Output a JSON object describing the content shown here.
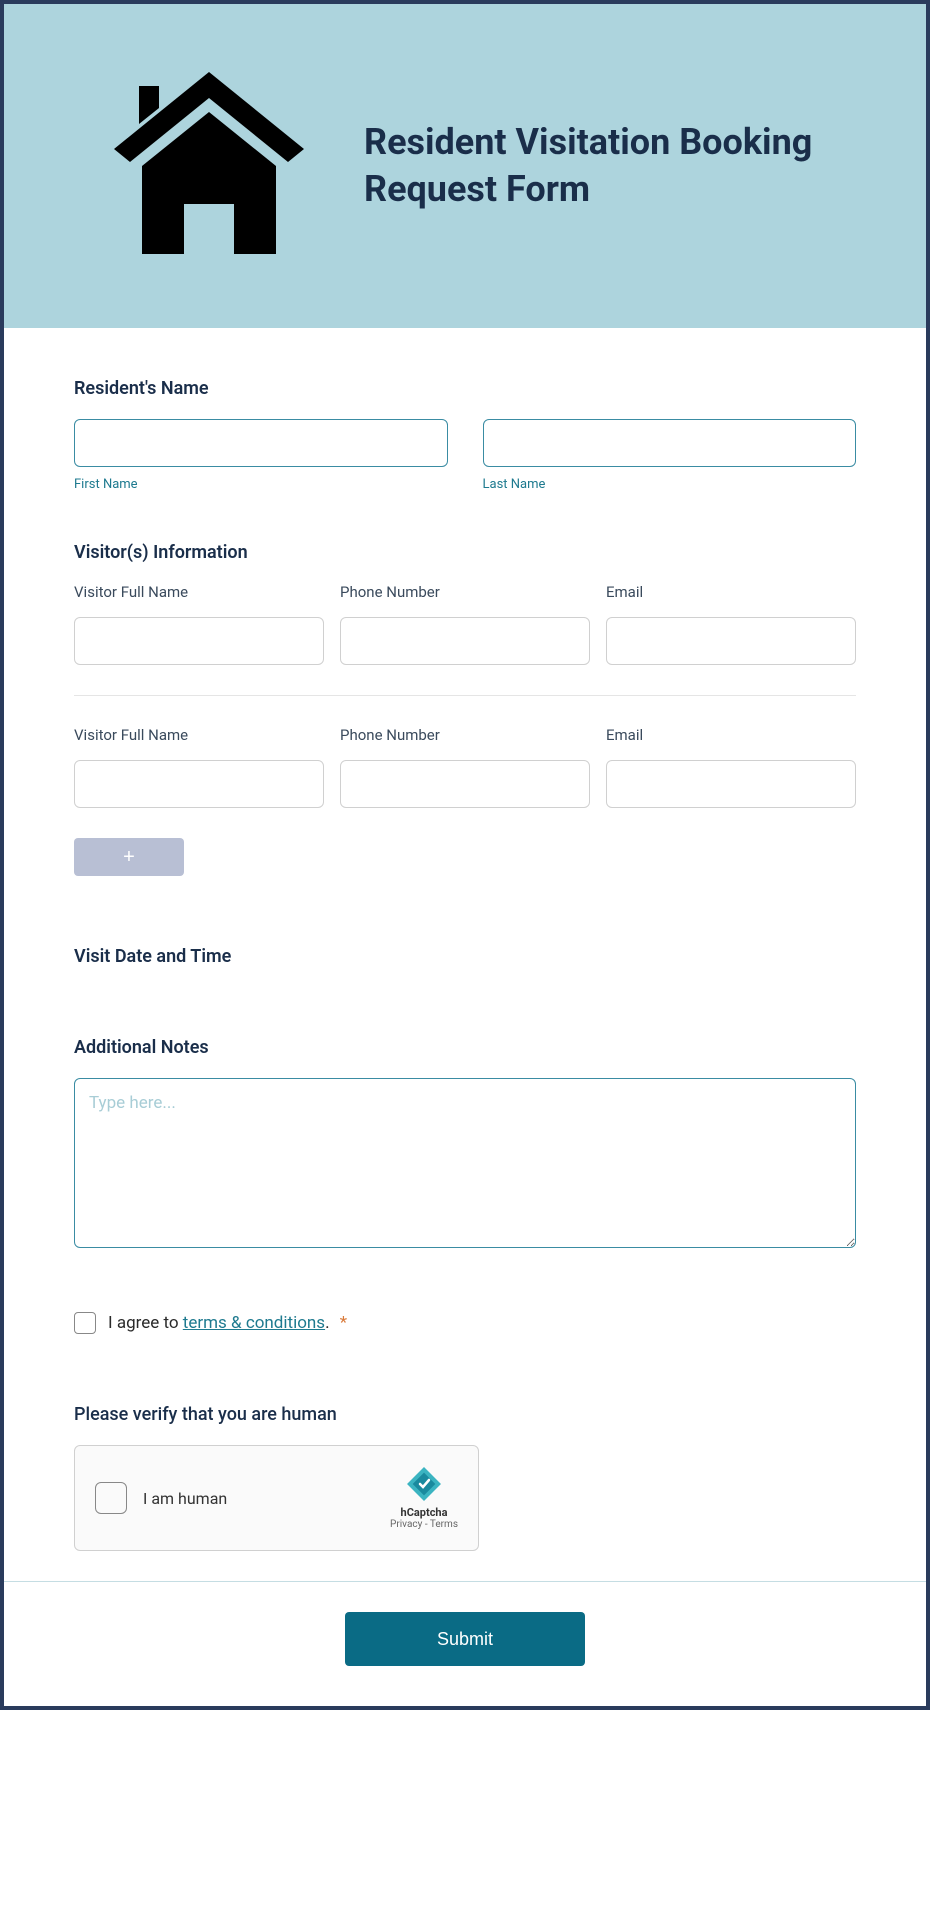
{
  "header": {
    "title": "Resident Visitation Booking Request Form"
  },
  "resident": {
    "label": "Resident's Name",
    "first_sublabel": "First Name",
    "last_sublabel": "Last Name"
  },
  "visitors": {
    "section_label": "Visitor(s) Information",
    "name_label": "Visitor Full Name",
    "phone_label": "Phone Number",
    "email_label": "Email",
    "add_label": "+"
  },
  "visit_datetime": {
    "label": "Visit Date and Time"
  },
  "notes": {
    "label": "Additional Notes",
    "placeholder": "Type here..."
  },
  "terms": {
    "prefix": "I agree to ",
    "link_text": "terms & conditions",
    "suffix": ".",
    "required": "*"
  },
  "captcha": {
    "label": "Please verify that you are human",
    "checkbox_label": "I am human",
    "brand": "hCaptcha",
    "links": "Privacy - Terms"
  },
  "submit": {
    "label": "Submit"
  }
}
